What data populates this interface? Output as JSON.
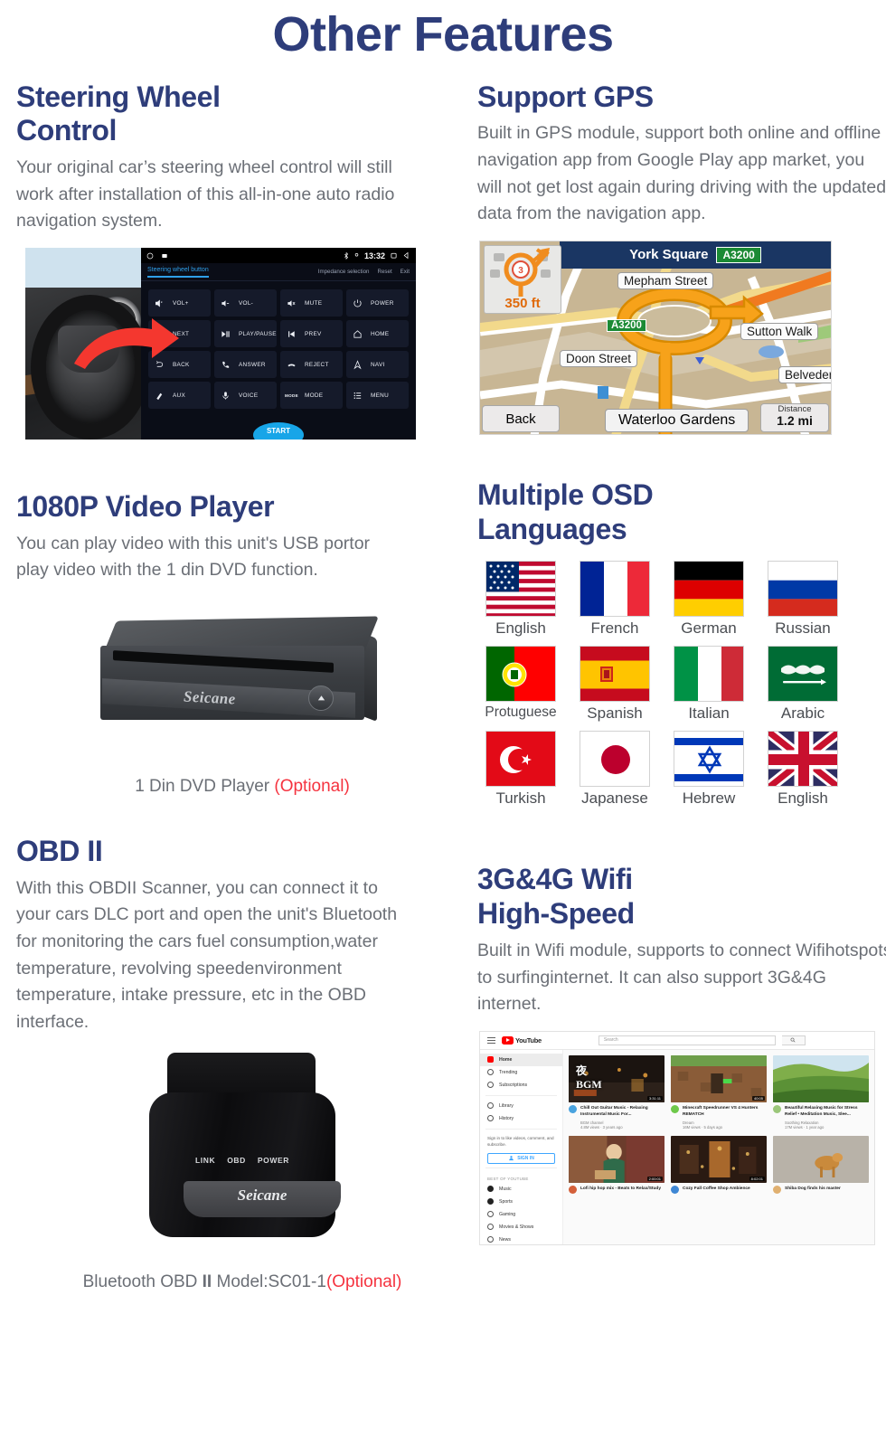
{
  "page": {
    "title": "Other Features",
    "accent_color": "#2e3d7a",
    "optional_color": "#f5333f",
    "body_color": "#6b6f76"
  },
  "features": {
    "steering": {
      "title": "Steering Wheel Control",
      "body": "Your original car’s steering wheel control will still work after installation of this all-in-one auto radio navigation system.",
      "screen": {
        "clock": "13:32",
        "tab_label": "Steering wheel button",
        "actions": [
          "Impedance selection",
          "Reset",
          "Exit"
        ],
        "start_label": "START",
        "buttons": [
          {
            "icon": "volume-up-icon",
            "label": "VOL+"
          },
          {
            "icon": "volume-down-icon",
            "label": "VOL-"
          },
          {
            "icon": "volume-mute-icon",
            "label": "MUTE"
          },
          {
            "icon": "power-icon",
            "label": "POWER"
          },
          {
            "icon": "next-track-icon",
            "label": "NEXT"
          },
          {
            "icon": "play-pause-icon",
            "label": "PLAY/PAUSE"
          },
          {
            "icon": "prev-track-icon",
            "label": "PREV"
          },
          {
            "icon": "home-icon",
            "label": "HOME"
          },
          {
            "icon": "back-arrow-icon",
            "label": "BACK"
          },
          {
            "icon": "phone-answer-icon",
            "label": "ANSWER"
          },
          {
            "icon": "phone-reject-icon",
            "label": "REJECT"
          },
          {
            "icon": "navigation-icon",
            "label": "NAVI"
          },
          {
            "icon": "aux-plug-icon",
            "label": "AUX"
          },
          {
            "icon": "microphone-icon",
            "label": "VOICE"
          },
          {
            "icon": "mode-text-icon",
            "label": "MODE"
          },
          {
            "icon": "menu-list-icon",
            "label": "MENU"
          }
        ]
      }
    },
    "gps": {
      "title": "Support GPS",
      "body": "Built in GPS module, support both online and offline navigation app from Google Play app market, you will not get lost again during driving with the updated data from the navigation app.",
      "map": {
        "header_street": "York Square",
        "header_road_badge": "A3200",
        "turn_exit_number": "3",
        "turn_distance": "350 ft",
        "road_badge": "A3200",
        "labels": [
          "Mepham Street",
          "Sutton Walk",
          "Doon Street",
          "Belvedere Rd"
        ],
        "back_label": "Back",
        "destination": "Waterloo Gardens",
        "distance_label": "Distance",
        "distance_value": "1.2 mi"
      }
    },
    "video": {
      "title": "1080P Video Player",
      "body": "You can play video with this unit's  USB portor play video with the 1 din DVD function.",
      "product_logo": "Seicane",
      "caption_text": "1 Din DVD Player ",
      "caption_optional": "(Optional)"
    },
    "osd": {
      "title": "Multiple OSD Languages",
      "flags": [
        [
          {
            "name": "English",
            "flag": "us-flag-icon"
          },
          {
            "name": "French",
            "flag": "france-flag-icon"
          },
          {
            "name": "German",
            "flag": "germany-flag-icon"
          },
          {
            "name": "Russian",
            "flag": "russia-flag-icon"
          }
        ],
        [
          {
            "name": "Protuguese",
            "flag": "portugal-flag-icon"
          },
          {
            "name": "Spanish",
            "flag": "spain-flag-icon"
          },
          {
            "name": "Italian",
            "flag": "italy-flag-icon"
          },
          {
            "name": "Arabic",
            "flag": "saudi-arabia-flag-icon"
          }
        ],
        [
          {
            "name": "Turkish",
            "flag": "turkey-flag-icon"
          },
          {
            "name": "Japanese",
            "flag": "japan-flag-icon"
          },
          {
            "name": "Hebrew",
            "flag": "israel-flag-icon"
          },
          {
            "name": "English",
            "flag": "uk-flag-icon"
          }
        ]
      ]
    },
    "obd": {
      "title": "OBD II",
      "body": "With this OBDII Scanner, you can connect it to your cars DLC port and open the unit's Bluetooth for monitoring the cars fuel consumption,water temperature, revolving speedenvironment temperature, intake pressure, etc in the OBD interface.",
      "device_leds": [
        "LINK",
        "OBD",
        "POWER"
      ],
      "device_logo": "Seicane",
      "device_foot_logo": "Seicane",
      "caption_text": "Bluetooth OBD ",
      "caption_bold": "II",
      "caption_model": " Model:SC01-1",
      "caption_optional": "(Optional)"
    },
    "wifi": {
      "title": "3G&4G Wifi High-Speed",
      "body": "Built in Wifi module, supports to connect  Wifihotspots to surfinginternet. It can also support 3G&4G internet.",
      "youtube": {
        "wordmark": "YouTube",
        "search_placeholder": "Search",
        "sidebar": [
          {
            "label": "Home",
            "icon": "home-icon"
          },
          {
            "label": "Trending",
            "icon": "trending-icon"
          },
          {
            "label": "Subscriptions",
            "icon": "subscriptions-icon"
          },
          {
            "label": "Library",
            "icon": "library-icon"
          },
          {
            "label": "History",
            "icon": "history-icon"
          }
        ],
        "signin_prompt": "Sign in to like videos, comment, and subscribe.",
        "signin_button": "SIGN IN",
        "section_title": "BEST OF YOUTUBE",
        "categories": [
          {
            "label": "Music",
            "icon": "music-icon"
          },
          {
            "label": "Sports",
            "icon": "sports-icon"
          },
          {
            "label": "Gaming",
            "icon": "gaming-icon"
          },
          {
            "label": "Movies & Shows",
            "icon": "movies-icon"
          },
          {
            "label": "News",
            "icon": "news-icon"
          }
        ],
        "videos_row1": [
          {
            "title": "Chill Out Guitar Music - Relaxing Instrumental Music For...",
            "channel": "BGM channel",
            "views": "4.8M views · 3 years ago",
            "duration": "3:31:11",
            "thumb": "night-street-bgm"
          },
          {
            "title": "Minecraft Speedrunner VS 4 Hunters REMATCH",
            "channel": "Dream",
            "views": "16M views · 5 days ago",
            "duration": "40:05",
            "thumb": "minecraft-gameplay"
          },
          {
            "title": "Beautiful Relaxing Music for Stress Relief • Meditation Music, Slee...",
            "channel": "Soothing Relaxation",
            "views": "17M views · 1 year ago",
            "duration": "",
            "thumb": "green-hills"
          }
        ],
        "videos_row2": [
          {
            "title": "Lofi hip hop mix - Beats to Relax/Study",
            "channel": "",
            "views": "",
            "duration": "2:00:01",
            "thumb": "lofi-girl-studying"
          },
          {
            "title": "Cozy Fall Coffee Shop Ambience",
            "channel": "",
            "views": "",
            "duration": "8:02:01",
            "thumb": "coffee-shop-interior"
          },
          {
            "title": "Shiba Dog finds his master",
            "channel": "",
            "views": "",
            "duration": "",
            "thumb": "shiba-dog"
          }
        ]
      }
    }
  }
}
